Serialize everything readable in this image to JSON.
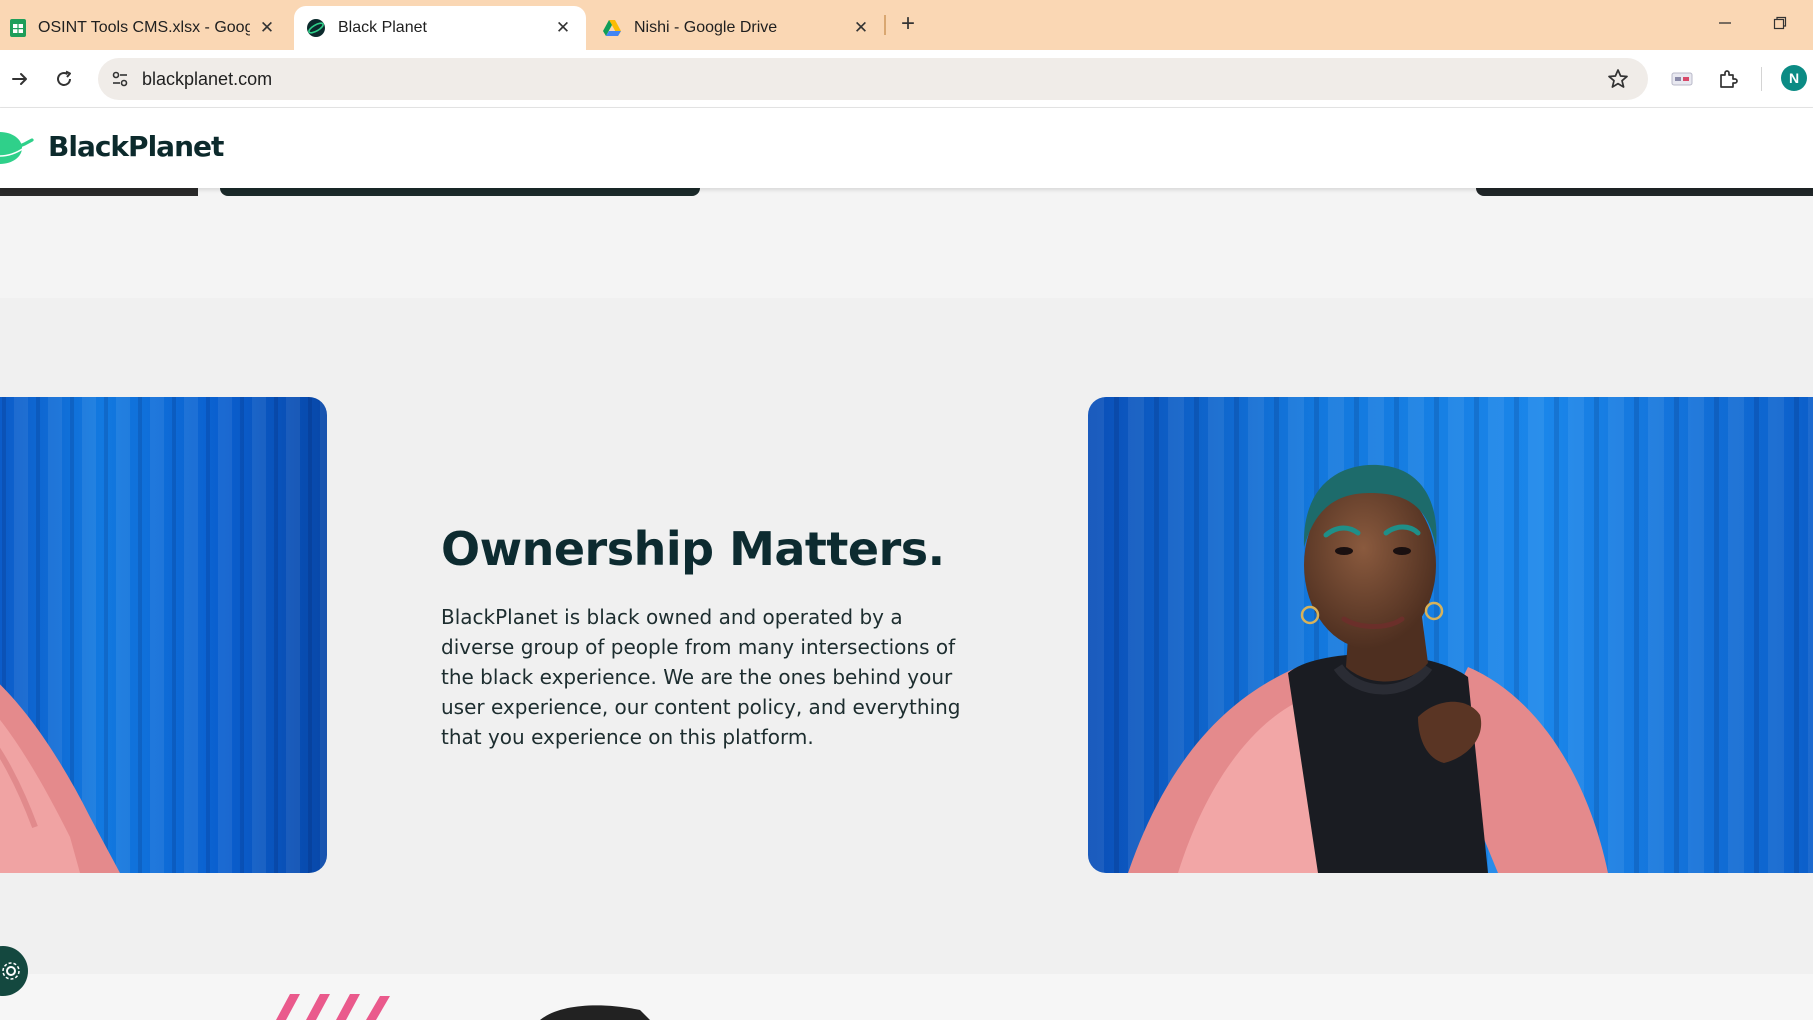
{
  "browser": {
    "tabs": [
      {
        "title": "OSINT Tools CMS.xlsx - Google",
        "favicon": "sheets-icon",
        "active": false
      },
      {
        "title": "Black Planet",
        "favicon": "blackplanet-icon",
        "active": true
      },
      {
        "title": "Nishi - Google Drive",
        "favicon": "drive-icon",
        "active": false
      }
    ],
    "url": "blackplanet.com",
    "profile_initial": "N",
    "colors": {
      "tabstrip": "#fad7b4",
      "profile": "#0b8b84"
    }
  },
  "site": {
    "logo_text": "BlackPlanet",
    "brand_colors": {
      "green": "#2fd08a",
      "dark": "#0c2a2c"
    }
  },
  "section": {
    "heading": "Ownership Matters.",
    "body": "BlackPlanet is black owned and operated by a diverse group of people from many intersections of the black experience. We are the ones behind your user experience, our content policy, and everything that you experience on this platform."
  }
}
